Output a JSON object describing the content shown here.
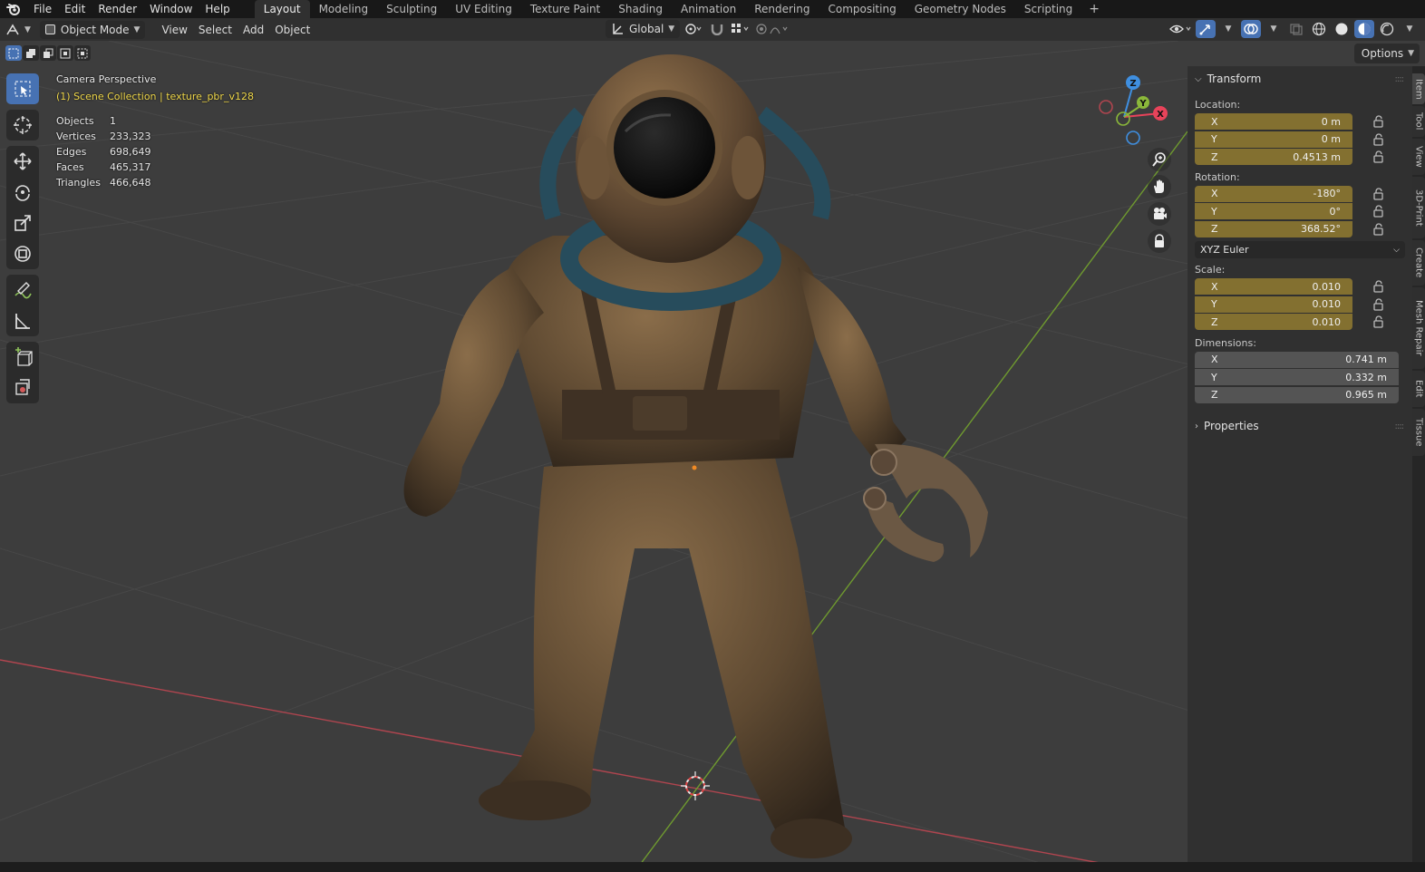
{
  "menubar": {
    "items": [
      "File",
      "Edit",
      "Render",
      "Window",
      "Help"
    ],
    "workspaces": [
      "Layout",
      "Modeling",
      "Sculpting",
      "UV Editing",
      "Texture Paint",
      "Shading",
      "Animation",
      "Rendering",
      "Compositing",
      "Geometry Nodes",
      "Scripting"
    ],
    "active_workspace": "Layout",
    "add_label": "+"
  },
  "header": {
    "mode": "Object Mode",
    "menus": [
      "View",
      "Select",
      "Add",
      "Object"
    ],
    "orientation": "Global"
  },
  "viewport": {
    "options_label": "Options",
    "camera_label": "Camera Perspective",
    "collection_label": "(1) Scene Collection | texture_pbr_v128",
    "stats": [
      {
        "label": "Objects",
        "value": "1"
      },
      {
        "label": "Vertices",
        "value": "233,323"
      },
      {
        "label": "Edges",
        "value": "698,649"
      },
      {
        "label": "Faces",
        "value": "465,317"
      },
      {
        "label": "Triangles",
        "value": "466,648"
      }
    ],
    "gizmo_axes": {
      "x": "X",
      "y": "Y",
      "z": "Z"
    }
  },
  "npanel": {
    "transform_title": "Transform",
    "location_label": "Location:",
    "location": [
      {
        "axis": "X",
        "value": "0 m"
      },
      {
        "axis": "Y",
        "value": "0 m"
      },
      {
        "axis": "Z",
        "value": "0.4513 m"
      }
    ],
    "rotation_label": "Rotation:",
    "rotation": [
      {
        "axis": "X",
        "value": "-180°"
      },
      {
        "axis": "Y",
        "value": "0°"
      },
      {
        "axis": "Z",
        "value": "368.52°"
      }
    ],
    "rotation_mode": "XYZ Euler",
    "scale_label": "Scale:",
    "scale": [
      {
        "axis": "X",
        "value": "0.010"
      },
      {
        "axis": "Y",
        "value": "0.010"
      },
      {
        "axis": "Z",
        "value": "0.010"
      }
    ],
    "dimensions_label": "Dimensions:",
    "dimensions": [
      {
        "axis": "X",
        "value": "0.741 m"
      },
      {
        "axis": "Y",
        "value": "0.332 m"
      },
      {
        "axis": "Z",
        "value": "0.965 m"
      }
    ],
    "properties_title": "Properties",
    "tabs": [
      "Item",
      "Tool",
      "View",
      "3D-Print",
      "Create",
      "Mesh Repair",
      "Edit",
      "Tissue"
    ]
  },
  "colors": {
    "accent_blue": "#4772b3",
    "field_gold": "#837030",
    "collection_yellow": "#f0d84a",
    "axis_x": "#e8435a",
    "axis_y": "#8bb83a",
    "axis_z": "#3f8fe0"
  }
}
